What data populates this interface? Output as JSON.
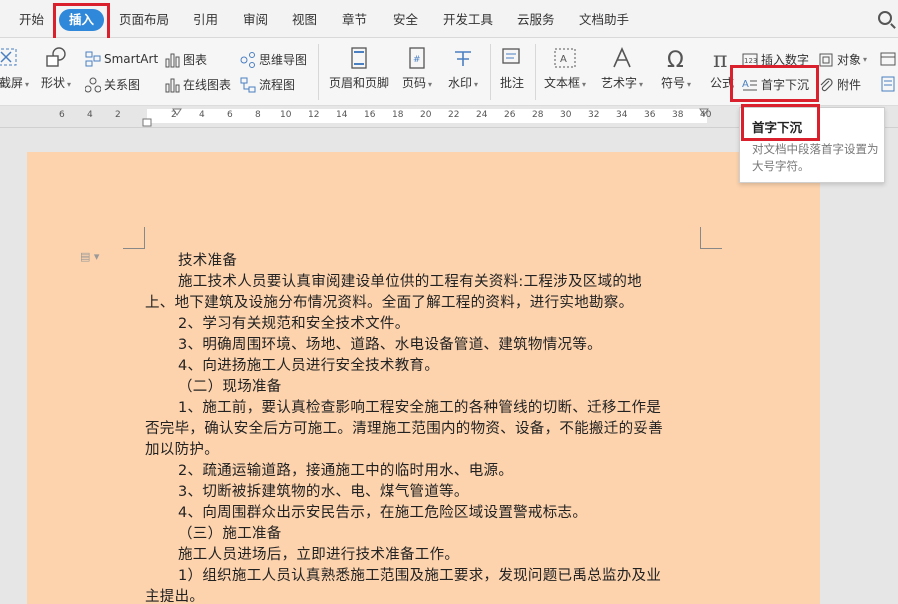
{
  "menu": {
    "tabs": [
      "开始",
      "插入",
      "页面布局",
      "引用",
      "审阅",
      "视图",
      "章节",
      "安全",
      "开发工具",
      "云服务",
      "文档助手"
    ],
    "active": "插入"
  },
  "ribbon": {
    "left_cut1": "截屏",
    "shapes": "形状",
    "smartart": "SmartArt",
    "relation": "关系图",
    "chart": "图表",
    "online_chart": "在线图表",
    "mindmap": "思维导图",
    "flowchart": "流程图",
    "header_footer": "页眉和页脚",
    "page_num": "页码",
    "watermark": "水印",
    "comment": "批注",
    "textbox": "文本框",
    "wordart": "艺术字",
    "symbol": "符号",
    "formula": "公式",
    "insert_number": "插入数字",
    "object": "对象",
    "drop_cap": "首字下沉",
    "attachment": "附件"
  },
  "ruler": {
    "numbers": [
      "6",
      "4",
      "2",
      "2",
      "4",
      "6",
      "8",
      "10",
      "12",
      "14",
      "16",
      "18",
      "20",
      "22",
      "24",
      "26",
      "28",
      "30",
      "32",
      "34",
      "36",
      "38",
      "40"
    ]
  },
  "tooltip": {
    "title": "首字下沉",
    "desc": "对文档中段落首字设置为大号字符。"
  },
  "document": {
    "lines": [
      "技术准备",
      "施工技术人员要认真审阅建设单位供的工程有关资料:工程涉及区域的地",
      "上、地下建筑及设施分布情况资料。全面了解工程的资料，进行实地勘察。",
      "2、学习有关规范和安全技术文件。",
      "3、明确周围环境、场地、道路、水电设备管道、建筑物情况等。",
      "4、向进扬施工人员进行安全技术教育。",
      "（二）现场准备",
      "1、施工前，要认真检查影响工程安全施工的各种管线的切断、迁移工作是",
      "否完毕，确认安全后方可施工。清理施工范围内的物资、设备，不能搬迁的妥善",
      "加以防护。",
      "2、疏通运输道路，接通施工中的临时用水、电源。",
      "3、切断被拆建筑物的水、电、煤气管道等。",
      "4、向周围群众出示安民告示，在施工危险区域设置警戒标志。",
      "（三）施工准备",
      "施工人员进场后，立即进行技术准备工作。",
      "1）组织施工人员认真熟悉施工范围及施工要求，发现问题已禹总监办及业",
      "主提出。"
    ]
  },
  "colors": {
    "accent": "#2f88d9",
    "highlight_box": "#d9202c",
    "page_bg": "#fdd3ae"
  }
}
